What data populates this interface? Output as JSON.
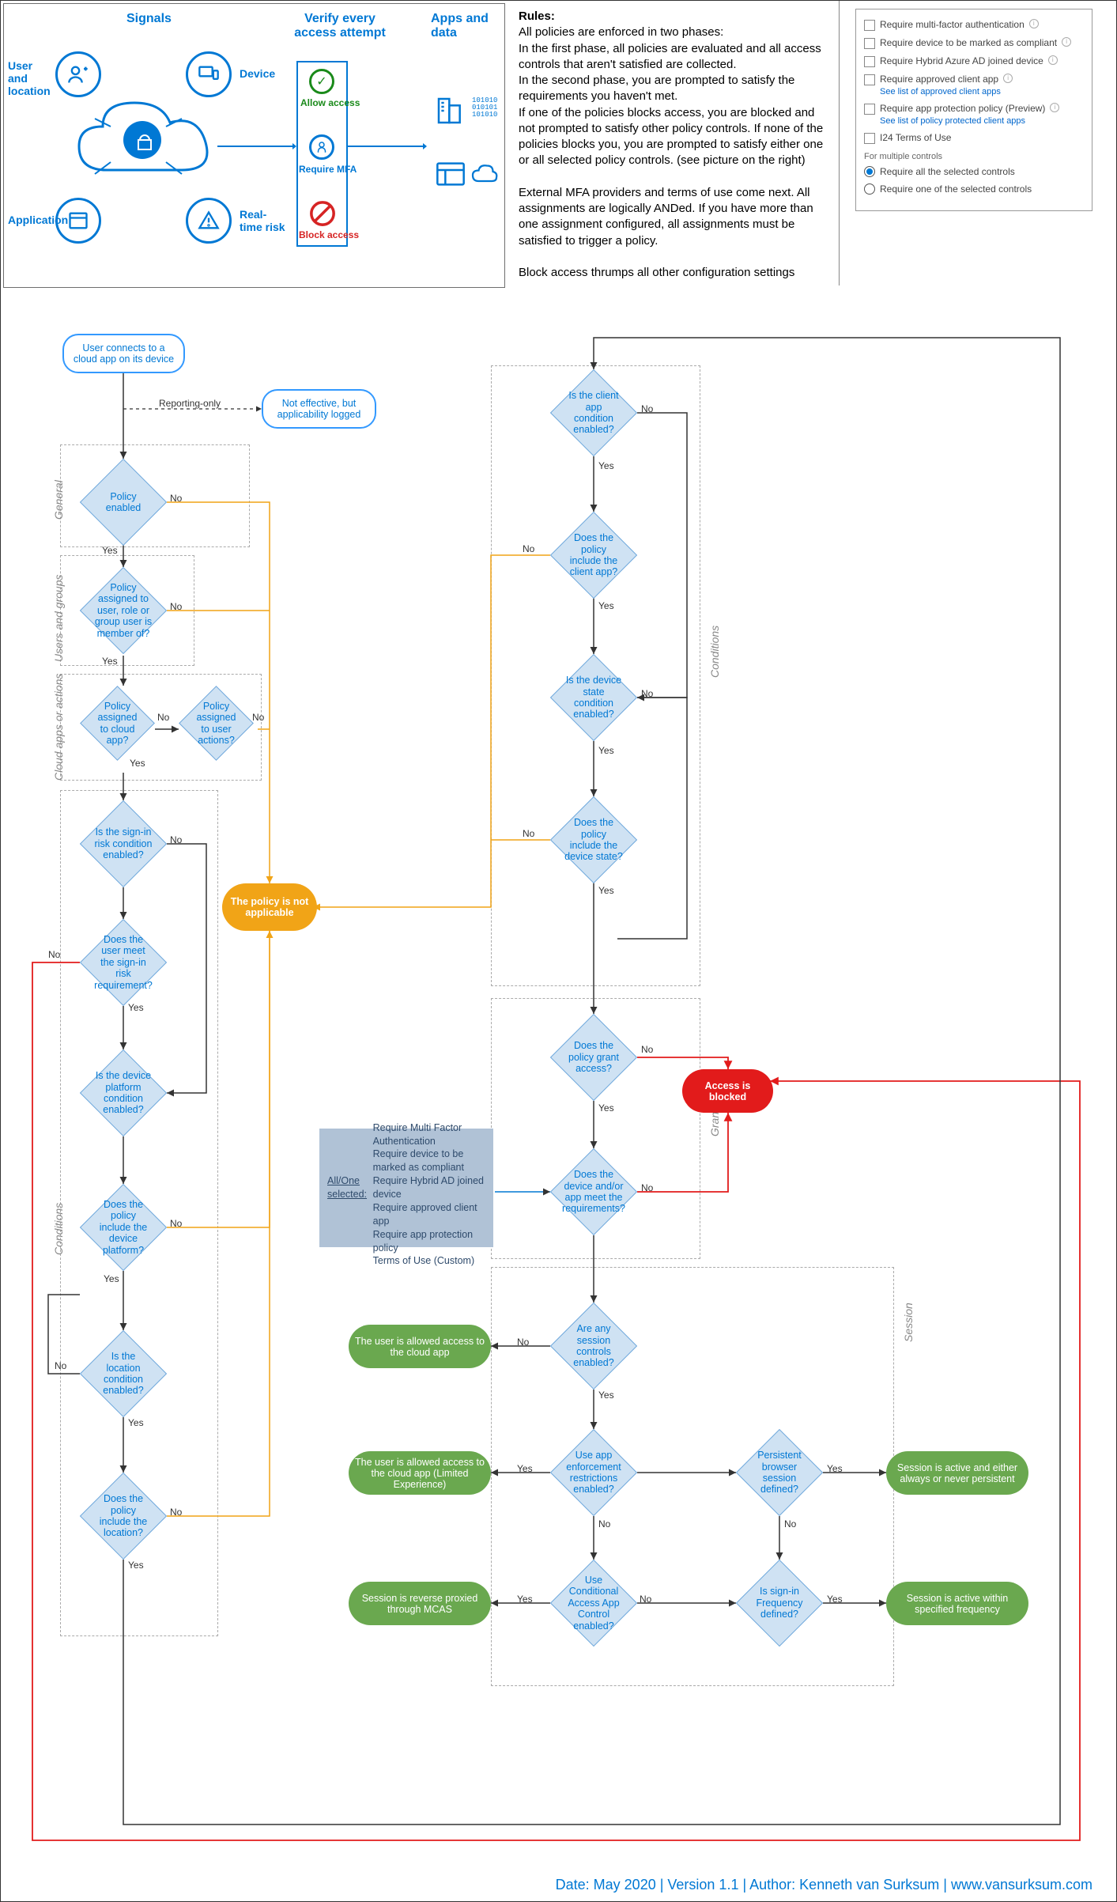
{
  "header": {
    "signals": "Signals",
    "verify": "Verify every access attempt",
    "apps": "Apps and data",
    "labels": {
      "user": "User and location",
      "device": "Device",
      "application": "Application",
      "risk": "Real-time risk",
      "allow": "Allow access",
      "mfa": "Require MFA",
      "block": "Block access"
    }
  },
  "rules": {
    "title": "Rules:",
    "p1": "All policies are enforced in two phases:",
    "p2": "In the first phase, all policies are evaluated and all access controls that aren't satisfied are collected.",
    "p3": "In the second phase, you are prompted to satisfy the requirements you haven't met.",
    "p4": "If one of the policies blocks access, you are blocked and not prompted to satisfy other policy controls. If none of the policies blocks you, you are prompted to satisfy either one or all selected policy controls. (see picture on the right)",
    "p5": "External MFA providers and terms of use come next. All assignments are logically ANDed. If you have more than one assignment configured, all assignments must be satisfied to trigger a policy.",
    "p6": "Block access thrumps all other configuration settings"
  },
  "settings": {
    "mfa": "Require multi-factor authentication",
    "compliant": "Require device to be marked as compliant",
    "hybrid": "Require Hybrid Azure AD joined device",
    "approved": "Require approved client app",
    "approved_link": "See list of approved client apps",
    "protection": "Require app protection policy (Preview)",
    "protection_link": "See list of policy protected client apps",
    "terms": "I24 Terms of Use",
    "multiple": "For multiple controls",
    "all": "Require all the selected controls",
    "one": "Require one of the selected controls"
  },
  "groups": {
    "general": "General",
    "users": "Users and groups",
    "cloudapps": "Cloud apps or actions",
    "conditions_left": "Conditions",
    "conditions_right": "Conditions",
    "grant": "Grant",
    "session": "Session"
  },
  "nodes": {
    "start": "User connects to a cloud app on its device",
    "reporting_lbl": "Reporting-only",
    "not_effective": "Not effective, but applicability logged",
    "policy_enabled": "Policy enabled",
    "policy_user": "Policy assigned to user, role or group user is member of?",
    "policy_cloudapp": "Policy assigned to cloud app?",
    "policy_actions": "Policy assigned to user actions?",
    "not_applicable": "The policy is not applicable",
    "signin_enabled": "Is the sign-in risk condition enabled?",
    "signin_meet": "Does the user meet the sign-in risk requirement?",
    "platform_enabled": "Is the device platform condition enabled?",
    "platform_include": "Does the policy include the device platform?",
    "location_enabled": "Is the location condition enabled?",
    "location_include": "Does the policy include the location?",
    "client_enabled": "Is the client app condition enabled?",
    "client_include": "Does the policy include the client app?",
    "state_enabled": "Is the device state condition enabled?",
    "state_include": "Does the policy include the device state?",
    "grant_access": "Does the policy grant access?",
    "meet_req": "Does the device and/or app meet the requirements?",
    "blocked": "Access is blocked",
    "req_info": "All/One selected:\nRequire Multi Factor Authentication\nRequire device to be marked as compliant\nRequire Hybrid AD joined device\nRequire approved client app\nRequire app protection policy\nTerms of Use (Custom)",
    "session_enabled": "Are any session controls enabled?",
    "allowed": "The user is allowed access to the cloud app",
    "app_enforce": "Use app enforcement restrictions enabled?",
    "limited": "The user is allowed access to the cloud app (Limited Experience)",
    "persistent": "Persistent browser session defined?",
    "persistent_result": "Session is active and either always or never persistent",
    "caac": "Use Conditional Access App Control enabled?",
    "mcas": "Session is reverse proxied through MCAS",
    "freq": "Is sign-in Frequency defined?",
    "freq_result": "Session is active within specified frequency"
  },
  "labels": {
    "yes": "Yes",
    "no": "No"
  },
  "footer": "Date: May 2020 | Version 1.1 | Author: Kenneth van Surksum | www.vansurksum.com"
}
